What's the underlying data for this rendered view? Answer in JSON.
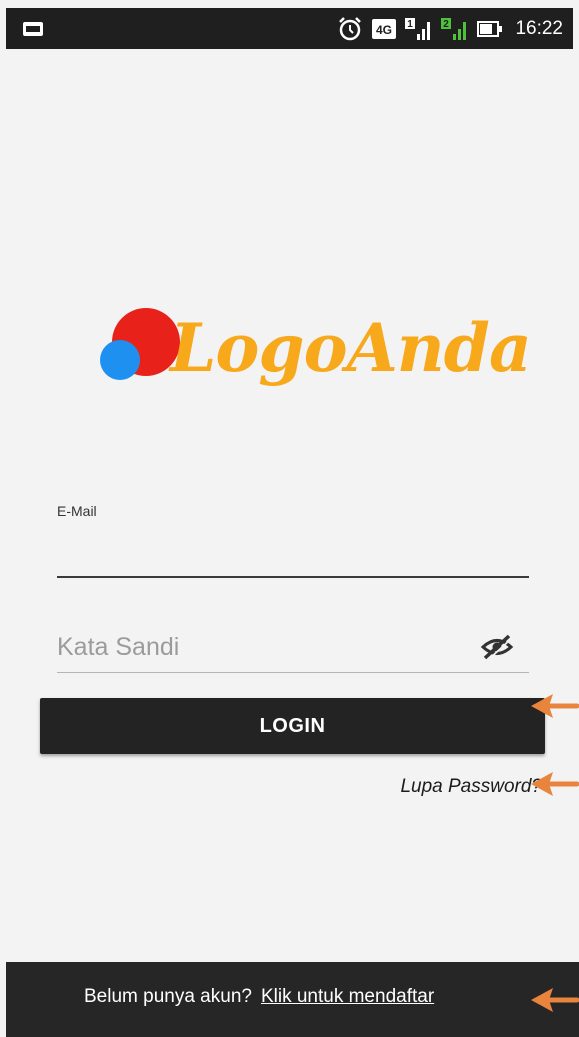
{
  "status_bar": {
    "time": "16:22",
    "network_label": "4G",
    "sim1_label": "1",
    "sim2_label": "2",
    "icons": [
      "notification-icon",
      "alarm-icon",
      "4g-icon",
      "signal-sim1-icon",
      "signal-sim2-icon",
      "battery-icon"
    ]
  },
  "logo": {
    "text": "LogoAnda",
    "colors": {
      "red": "#e8221b",
      "blue": "#1e90f0",
      "orange": "#f7a81b"
    }
  },
  "form": {
    "email_label": "E-Mail",
    "email_value": "",
    "password_placeholder": "Kata Sandi",
    "password_value": "",
    "visibility_icon": "eye-off-icon",
    "login_label": "LOGIN",
    "forgot_label": "Lupa Password?"
  },
  "footer": {
    "prompt": "Belum punya akun?",
    "register_label": "Klik untuk mendaftar"
  },
  "annotations": {
    "arrow_color": "#e8843c"
  }
}
